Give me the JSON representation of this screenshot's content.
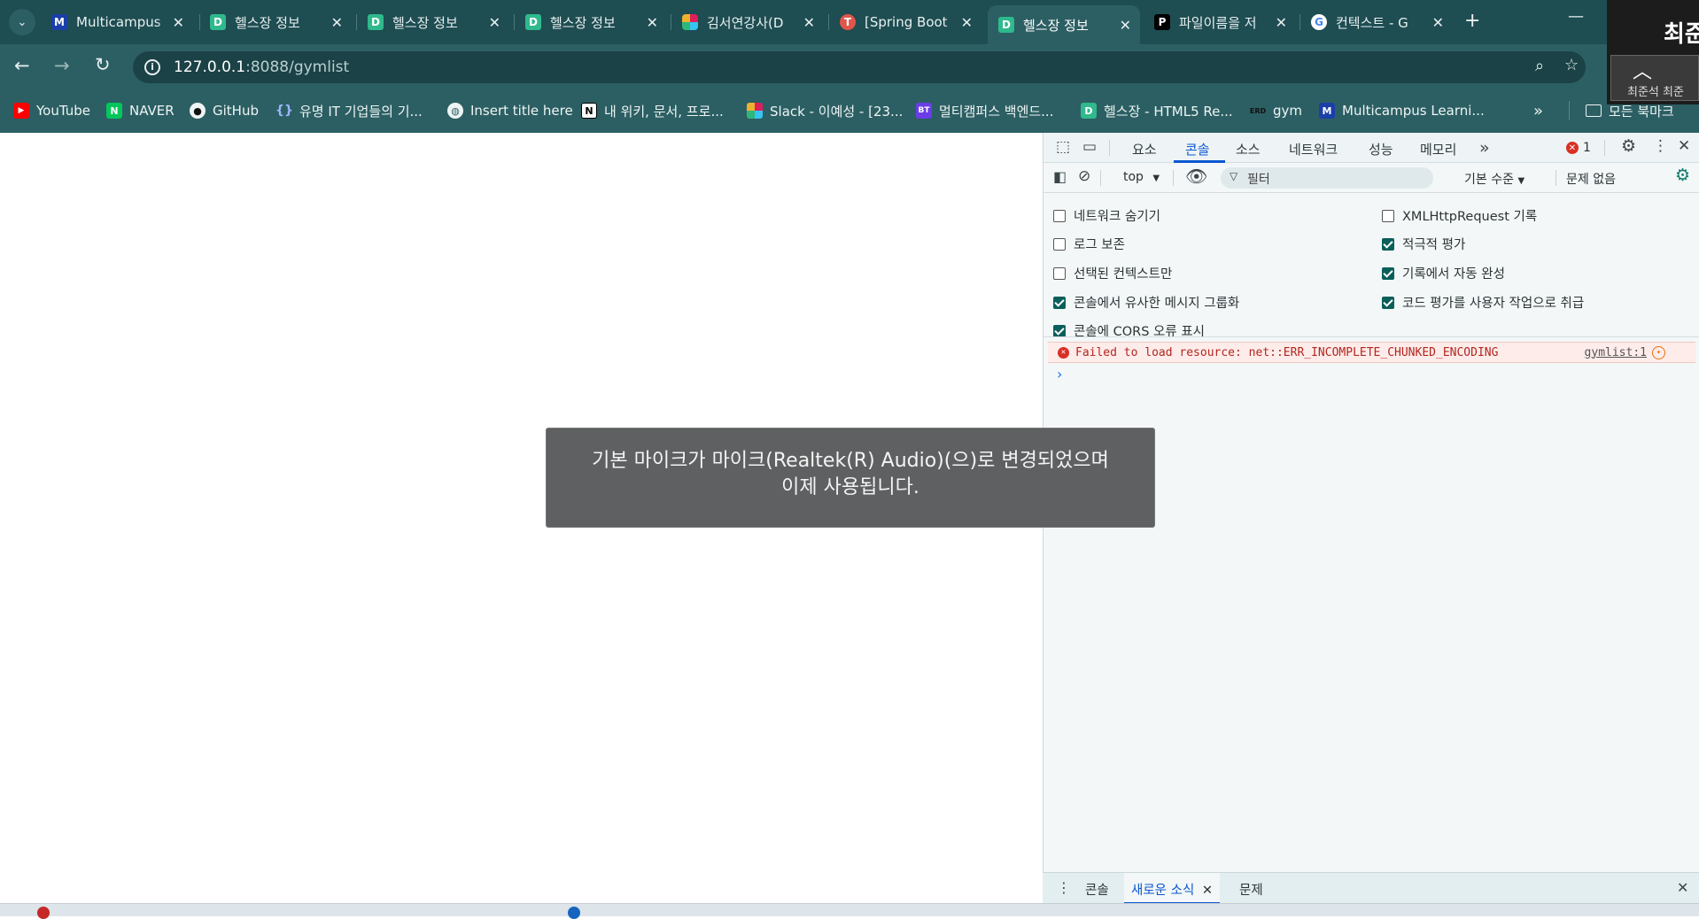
{
  "tabs": [
    {
      "title": "Multicampus",
      "icon": "multicampus-icon"
    },
    {
      "title": "헬스장 정보",
      "icon": "d-icon"
    },
    {
      "title": "헬스장 정보",
      "icon": "d-icon"
    },
    {
      "title": "헬스장 정보",
      "icon": "d-icon"
    },
    {
      "title": "김서연강사(D",
      "icon": "slack-icon"
    },
    {
      "title": "[Spring Boot",
      "icon": "spring-icon"
    },
    {
      "title": "헬스장 정보",
      "icon": "d-icon",
      "active": true
    },
    {
      "title": "파일이름을 저",
      "icon": "p-icon"
    },
    {
      "title": "컨텍스트 - G",
      "icon": "google-icon"
    }
  ],
  "address": {
    "host": "127.0.0.1",
    "rest": ":8088/gymlist"
  },
  "bookmarks": [
    {
      "label": "YouTube",
      "icon": "youtube-icon"
    },
    {
      "label": "NAVER",
      "icon": "naver-icon"
    },
    {
      "label": "GitHub",
      "icon": "github-icon"
    },
    {
      "label": "유명 IT 기업들의 기...",
      "icon": "braces-icon"
    },
    {
      "label": "Insert title here",
      "icon": "globe-icon"
    },
    {
      "label": "내 위키, 문서, 프로...",
      "icon": "notion-icon"
    },
    {
      "label": "Slack - 이예성 - [23...",
      "icon": "slack-icon"
    },
    {
      "label": "멀티캠퍼스 백엔드...",
      "icon": "bt-icon"
    },
    {
      "label": "헬스장 - HTML5 Re...",
      "icon": "d-icon"
    },
    {
      "label": "gym",
      "icon": "erd-icon"
    },
    {
      "label": "Multicampus Learni...",
      "icon": "multicampus-icon"
    }
  ],
  "bookmarks_folder": "모든 북마크",
  "overlay": {
    "big_text": "최준",
    "small_text": "최준석 최준"
  },
  "devtools": {
    "tabs": [
      "요소",
      "콘솔",
      "소스",
      "네트워크",
      "성능",
      "메모리"
    ],
    "active_tab": "콘솔",
    "error_count": "1",
    "context": "top",
    "filter_placeholder": "필터",
    "level": "기본 수준",
    "issues": "문제 없음",
    "settings_left": [
      {
        "label": "네트워크 숨기기",
        "checked": false
      },
      {
        "label": "로그 보존",
        "checked": false
      },
      {
        "label": "선택된 컨텍스트만",
        "checked": false
      },
      {
        "label": "콘솔에서 유사한 메시지 그룹화",
        "checked": true
      },
      {
        "label": "콘솔에 CORS 오류 표시",
        "checked": true
      }
    ],
    "settings_right": [
      {
        "label": "XMLHttpRequest 기록",
        "checked": false
      },
      {
        "label": "적극적 평가",
        "checked": true
      },
      {
        "label": "기록에서 자동 완성",
        "checked": true
      },
      {
        "label": "코드 평가를 사용자 작업으로 취급",
        "checked": true
      }
    ],
    "error_message": "Failed to load resource: net::ERR_INCOMPLETE_CHUNKED_ENCODING",
    "error_source": "gymlist:1",
    "prompt": "›",
    "drawer_tabs": [
      "콘솔",
      "새로운 소식",
      "문제"
    ],
    "drawer_active": "새로운 소식"
  },
  "toast": {
    "line1": "기본 마이크가 마이크(Realtek(R) Audio)(으)로 변경되었으며",
    "line2": "이제 사용됩니다."
  },
  "colors": {
    "frame": "#1e4d52",
    "toolbar": "#2c5f63",
    "accent": "#0b57d0",
    "error": "#b3261e"
  }
}
